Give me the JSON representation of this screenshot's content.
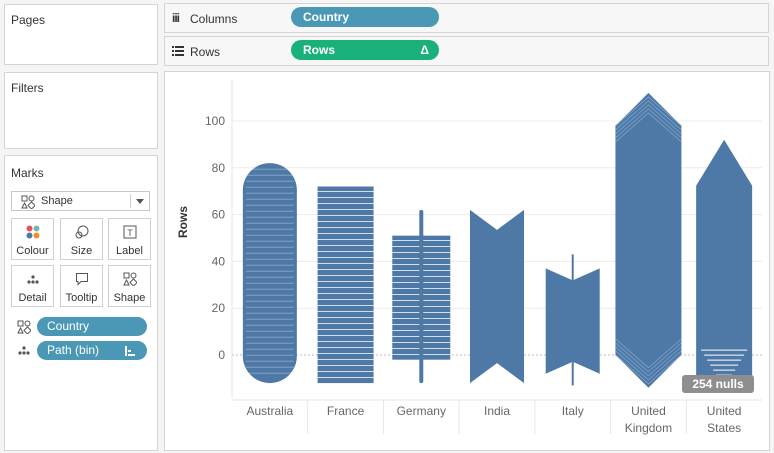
{
  "pages": {
    "title": "Pages"
  },
  "filters": {
    "title": "Filters"
  },
  "marks": {
    "title": "Marks",
    "mark_type": "Shape",
    "buttons": {
      "colour": "Colour",
      "size": "Size",
      "label": "Label",
      "detail": "Detail",
      "tooltip": "Tooltip",
      "shape": "Shape"
    },
    "fields": [
      {
        "icon": "shape-encoding-icon",
        "name": "Country"
      },
      {
        "icon": "detail-encoding-icon",
        "name": "Path (bin)"
      }
    ]
  },
  "shelves": {
    "columns": {
      "label": "Columns",
      "pill": "Country"
    },
    "rows": {
      "label": "Rows",
      "pill": "Rows",
      "pill_icon": "Δ"
    }
  },
  "colors": {
    "accent": "#4a98b6",
    "rows_pill": "#1ab07a",
    "mark": "#4e79a7",
    "null_badge": "#8e8e8e"
  },
  "chart_data": {
    "type": "scatter",
    "mark": "shape",
    "categories": [
      "Australia",
      "France",
      "Germany",
      "India",
      "Italy",
      "United Kingdom",
      "United States"
    ],
    "ylabel": "Rows",
    "ylim": [
      -17,
      120
    ],
    "yticks": [
      0,
      20,
      40,
      60,
      80,
      100
    ],
    "grid": true,
    "series": [
      {
        "category": "Australia",
        "min": -12,
        "max": 82
      },
      {
        "category": "France",
        "min": -12,
        "max": 72
      },
      {
        "category": "Germany",
        "min": -12,
        "max": 62
      },
      {
        "category": "India",
        "min": -12,
        "max": 62
      },
      {
        "category": "Italy",
        "min": -13,
        "max": 43
      },
      {
        "category": "United Kingdom",
        "min": -14,
        "max": 112
      },
      {
        "category": "United States",
        "min": -12,
        "max": 92
      }
    ],
    "annotation": "254 nulls"
  }
}
